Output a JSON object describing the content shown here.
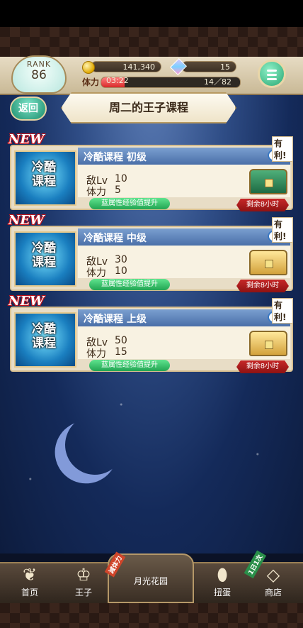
{
  "status": {
    "rank_label": "RANK",
    "rank_value": "86",
    "coins": "141,340",
    "gems": "15",
    "stamina_label": "体力",
    "stamina_timer": "03:22",
    "stamina_current": 14,
    "stamina_max": 82,
    "stamina_text": "14／82"
  },
  "nav_top": {
    "back_label": "返回",
    "title": "周二的王子课程"
  },
  "quests": [
    {
      "new_label": "NEW",
      "advantage_label": "有利!",
      "icon_text": "冷酷课程",
      "name": "冷酷课程 初级",
      "enemy_label": "敌Lv",
      "enemy_level": "10",
      "stamina_label": "体力",
      "stamina_cost": "5",
      "bonus": "蓝属性经验值提升",
      "remaining": "剩余8小时",
      "chest": "green"
    },
    {
      "new_label": "NEW",
      "advantage_label": "有利!",
      "icon_text": "冷酷课程",
      "name": "冷酷课程 中级",
      "enemy_label": "敌Lv",
      "enemy_level": "30",
      "stamina_label": "体力",
      "stamina_cost": "10",
      "bonus": "蓝属性经验值提升",
      "remaining": "剩余8小时",
      "chest": "gold"
    },
    {
      "new_label": "NEW",
      "advantage_label": "有利!",
      "icon_text": "冷酷课程",
      "name": "冷酷课程 上级",
      "enemy_label": "敌Lv",
      "enemy_level": "50",
      "stamina_label": "体力",
      "stamina_cost": "15",
      "bonus": "蓝属性经验值提升",
      "remaining": "剩余8小时",
      "chest": "gold"
    }
  ],
  "bottom_nav": {
    "home": "首页",
    "prince": "王子",
    "garden": "月光花园",
    "garden_flag": "減体力",
    "gacha": "扭蛋",
    "shop": "商店",
    "shop_flag": "1日1次"
  },
  "colors": {
    "accent_green": "#28a672",
    "header_bg": "#e7dcc4",
    "quest_header": "#4a6fa8",
    "remaining_red": "#c62828"
  }
}
